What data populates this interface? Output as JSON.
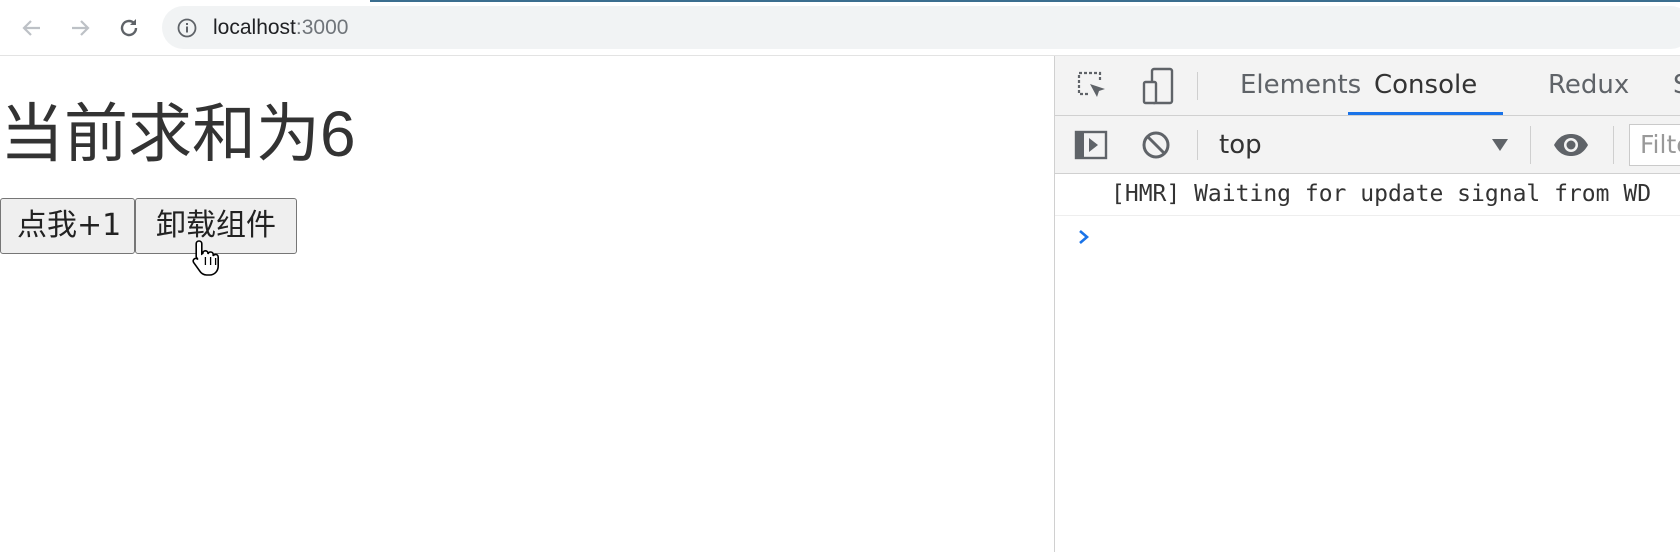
{
  "browser": {
    "url_host": "localhost",
    "url_port": ":3000",
    "back_icon": "arrow-left-icon",
    "forward_icon": "arrow-right-icon",
    "reload_icon": "reload-icon",
    "info_icon": "info-icon"
  },
  "page": {
    "heading": "当前求和为6",
    "increment_button": "点我+1",
    "unmount_button": "卸载组件"
  },
  "devtools": {
    "tabs": [
      {
        "label": "Elements",
        "active": false
      },
      {
        "label": "Console",
        "active": true
      },
      {
        "label": "Redux",
        "active": false
      },
      {
        "label": "S",
        "active": false
      }
    ],
    "context": "top",
    "filter_placeholder": "Filte",
    "log": "[HMR] Waiting for update signal from WD",
    "accent_color": "#1a73e8"
  }
}
